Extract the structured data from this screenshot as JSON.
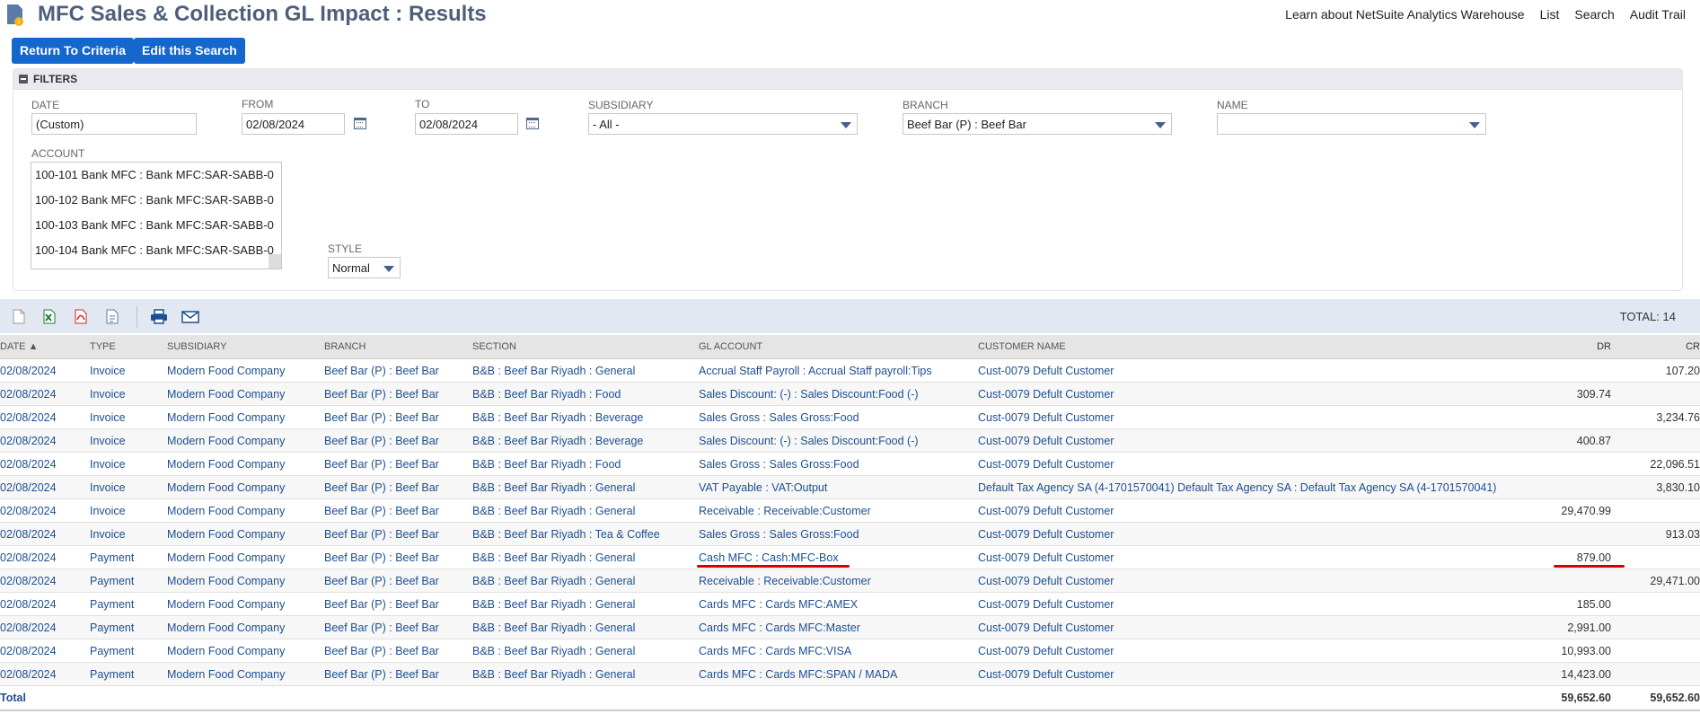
{
  "header": {
    "title": "MFC Sales & Collection GL Impact : Results",
    "links": [
      "Learn about NetSuite Analytics Warehouse",
      "List",
      "Search",
      "Audit Trail"
    ]
  },
  "buttons": {
    "return_label": "Return To Criteria",
    "edit_label": "Edit this Search"
  },
  "filters": {
    "section_label": "FILTERS",
    "date": {
      "label": "DATE",
      "value": "(Custom)"
    },
    "from": {
      "label": "FROM",
      "value": "02/08/2024"
    },
    "to": {
      "label": "TO",
      "value": "02/08/2024"
    },
    "subsidiary": {
      "label": "SUBSIDIARY",
      "value": "- All -"
    },
    "branch": {
      "label": "BRANCH",
      "value": "Beef Bar (P) : Beef Bar"
    },
    "name": {
      "label": "NAME",
      "value": ""
    },
    "account": {
      "label": "ACCOUNT",
      "items": [
        "100-101 Bank MFC : Bank MFC:SAR-SABB-0",
        "100-102 Bank MFC : Bank MFC:SAR-SABB-0",
        "100-103 Bank MFC : Bank MFC:SAR-SABB-0",
        "100-104 Bank MFC : Bank MFC:SAR-SABB-0"
      ]
    },
    "style": {
      "label": "STYLE",
      "value": "Normal"
    }
  },
  "toolbar": {
    "total": "TOTAL: 14"
  },
  "table": {
    "columns": [
      "DATE ▲",
      "TYPE",
      "SUBSIDIARY",
      "BRANCH",
      "SECTION",
      "GL ACCOUNT",
      "CUSTOMER NAME",
      "DR",
      "CR"
    ],
    "rows": [
      [
        "02/08/2024",
        "Invoice",
        "Modern Food Company",
        "Beef Bar (P) : Beef Bar",
        "B&B : Beef Bar Riyadh : General",
        "Accrual Staff Payroll : Accrual Staff payroll:Tips",
        "Cust-0079 Defult Customer",
        "",
        "107.20"
      ],
      [
        "02/08/2024",
        "Invoice",
        "Modern Food Company",
        "Beef Bar (P) : Beef Bar",
        "B&B : Beef Bar Riyadh : Food",
        "Sales Discount: (-) : Sales Discount:Food (-)",
        "Cust-0079 Defult Customer",
        "309.74",
        ""
      ],
      [
        "02/08/2024",
        "Invoice",
        "Modern Food Company",
        "Beef Bar (P) : Beef Bar",
        "B&B : Beef Bar Riyadh : Beverage",
        "Sales Gross : Sales Gross:Food",
        "Cust-0079 Defult Customer",
        "",
        "3,234.76"
      ],
      [
        "02/08/2024",
        "Invoice",
        "Modern Food Company",
        "Beef Bar (P) : Beef Bar",
        "B&B : Beef Bar Riyadh : Beverage",
        "Sales Discount: (-) : Sales Discount:Food (-)",
        "Cust-0079 Defult Customer",
        "400.87",
        ""
      ],
      [
        "02/08/2024",
        "Invoice",
        "Modern Food Company",
        "Beef Bar (P) : Beef Bar",
        "B&B : Beef Bar Riyadh : Food",
        "Sales Gross : Sales Gross:Food",
        "Cust-0079 Defult Customer",
        "",
        "22,096.51"
      ],
      [
        "02/08/2024",
        "Invoice",
        "Modern Food Company",
        "Beef Bar (P) : Beef Bar",
        "B&B : Beef Bar Riyadh : General",
        "VAT Payable : VAT:Output",
        "Default Tax Agency SA (4-1701570041) Default Tax Agency SA : Default Tax Agency SA (4-1701570041)",
        "",
        "3,830.10"
      ],
      [
        "02/08/2024",
        "Invoice",
        "Modern Food Company",
        "Beef Bar (P) : Beef Bar",
        "B&B : Beef Bar Riyadh : General",
        "Receivable : Receivable:Customer",
        "Cust-0079 Defult Customer",
        "29,470.99",
        ""
      ],
      [
        "02/08/2024",
        "Invoice",
        "Modern Food Company",
        "Beef Bar (P) : Beef Bar",
        "B&B : Beef Bar Riyadh : Tea & Coffee",
        "Sales Gross : Sales Gross:Food",
        "Cust-0079 Defult Customer",
        "",
        "913.03"
      ],
      [
        "02/08/2024",
        "Payment",
        "Modern Food Company",
        "Beef Bar (P) : Beef Bar",
        "B&B : Beef Bar Riyadh : General",
        "Cash MFC : Cash:MFC-Box",
        "Cust-0079 Defult Customer",
        "879.00",
        ""
      ],
      [
        "02/08/2024",
        "Payment",
        "Modern Food Company",
        "Beef Bar (P) : Beef Bar",
        "B&B : Beef Bar Riyadh : General",
        "Receivable : Receivable:Customer",
        "Cust-0079 Defult Customer",
        "",
        "29,471.00"
      ],
      [
        "02/08/2024",
        "Payment",
        "Modern Food Company",
        "Beef Bar (P) : Beef Bar",
        "B&B : Beef Bar Riyadh : General",
        "Cards MFC : Cards MFC:AMEX",
        "Cust-0079 Defult Customer",
        "185.00",
        ""
      ],
      [
        "02/08/2024",
        "Payment",
        "Modern Food Company",
        "Beef Bar (P) : Beef Bar",
        "B&B : Beef Bar Riyadh : General",
        "Cards MFC : Cards MFC:Master",
        "Cust-0079 Defult Customer",
        "2,991.00",
        ""
      ],
      [
        "02/08/2024",
        "Payment",
        "Modern Food Company",
        "Beef Bar (P) : Beef Bar",
        "B&B : Beef Bar Riyadh : General",
        "Cards MFC : Cards MFC:VISA",
        "Cust-0079 Defult Customer",
        "10,993.00",
        ""
      ],
      [
        "02/08/2024",
        "Payment",
        "Modern Food Company",
        "Beef Bar (P) : Beef Bar",
        "B&B : Beef Bar Riyadh : General",
        "Cards MFC : Cards MFC:SPAN / MADA",
        "Cust-0079 Defult Customer",
        "14,423.00",
        ""
      ]
    ],
    "total": {
      "label": "Total",
      "dr": "59,652.60",
      "cr": "59,652.60"
    }
  },
  "colors": {
    "accent": "#1467cc",
    "title": "#4d5f79",
    "link": "#1d4f91",
    "annotation": "#d40000"
  }
}
